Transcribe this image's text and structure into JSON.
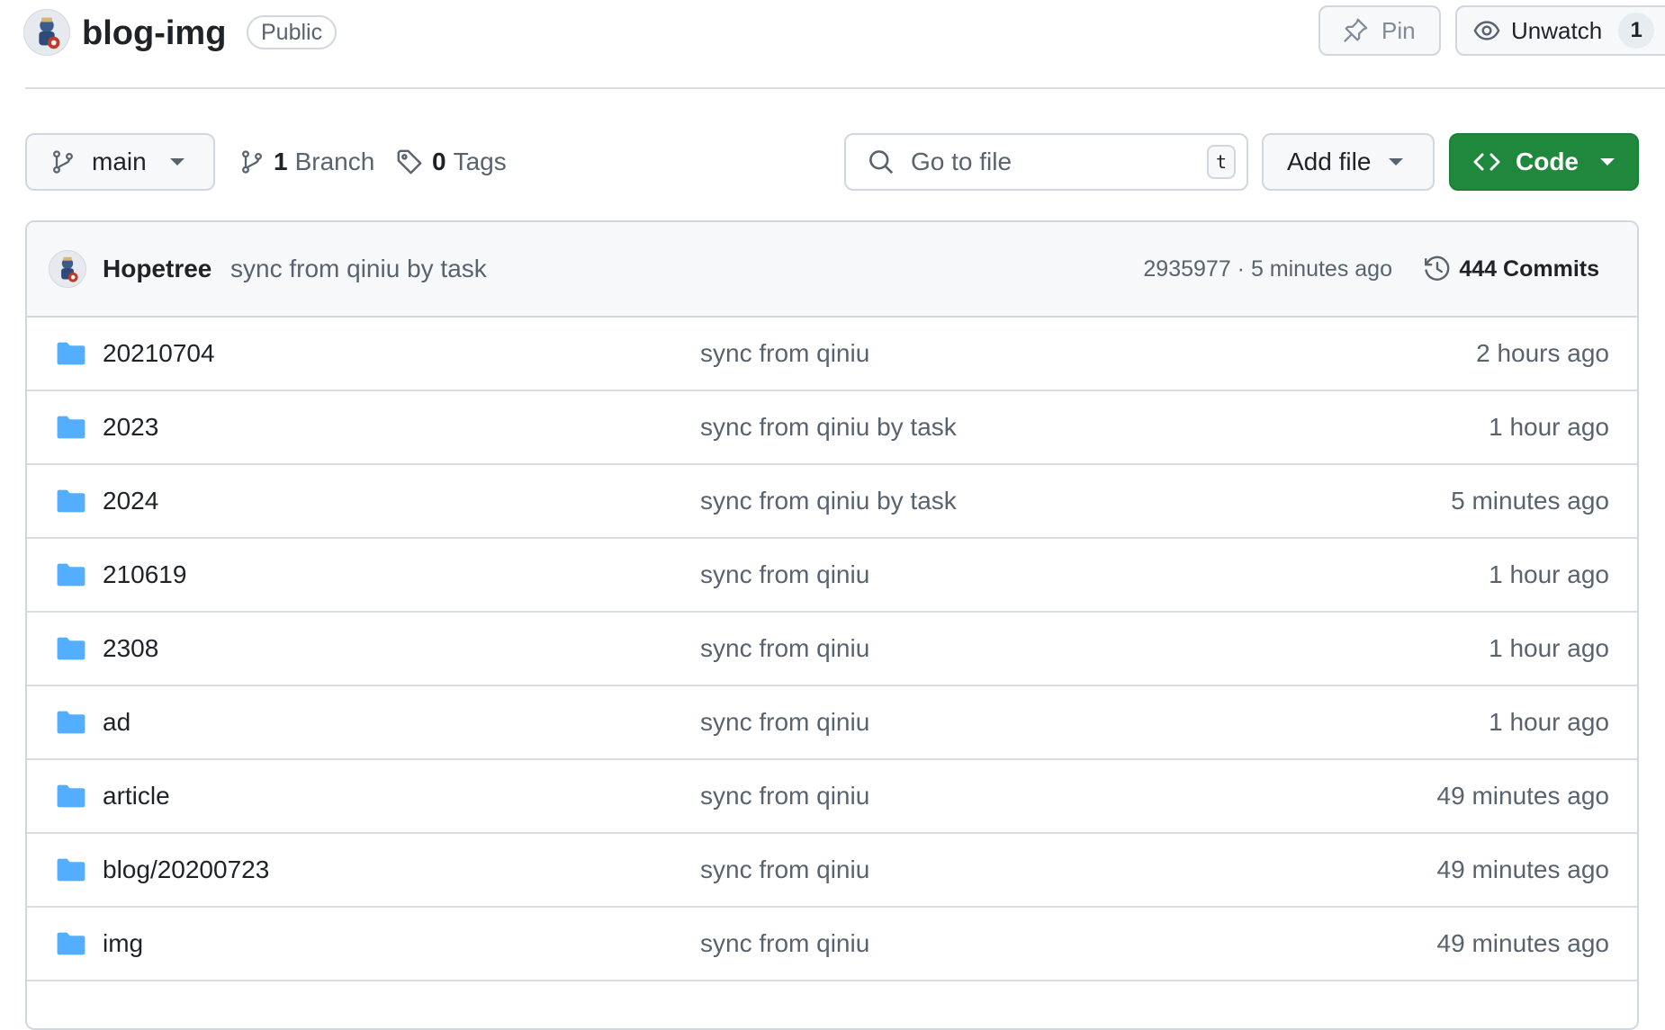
{
  "repo": {
    "name": "blog-img",
    "visibility": "Public"
  },
  "header_actions": {
    "pin_label": "Pin",
    "unwatch_label": "Unwatch",
    "watch_count": "1"
  },
  "toolbar": {
    "branch_name": "main",
    "branches_count": "1",
    "branches_label": "Branch",
    "tags_count": "0",
    "tags_label": "Tags",
    "search_placeholder": "Go to file",
    "search_shortcut": "t",
    "add_file_label": "Add file",
    "code_label": "Code"
  },
  "latest_commit": {
    "author": "Hopetree",
    "message": "sync from qiniu by task",
    "meta": "2935977 · 5 minutes ago",
    "commits_label": "444 Commits"
  },
  "files": [
    {
      "name": "20210704",
      "message": "sync from qiniu",
      "time": "2 hours ago"
    },
    {
      "name": "2023",
      "message": "sync from qiniu by task",
      "time": "1 hour ago"
    },
    {
      "name": "2024",
      "message": "sync from qiniu by task",
      "time": "5 minutes ago"
    },
    {
      "name": "210619",
      "message": "sync from qiniu",
      "time": "1 hour ago"
    },
    {
      "name": "2308",
      "message": "sync from qiniu",
      "time": "1 hour ago"
    },
    {
      "name": "ad",
      "message": "sync from qiniu",
      "time": "1 hour ago"
    },
    {
      "name": "article",
      "message": "sync from qiniu",
      "time": "49 minutes ago"
    },
    {
      "name": "blog/20200723",
      "message": "sync from qiniu",
      "time": "49 minutes ago"
    },
    {
      "name": "img",
      "message": "sync from qiniu",
      "time": "49 minutes ago"
    }
  ],
  "icons": {
    "folder": "folder-icon",
    "branch": "git-branch-icon",
    "tag": "tag-icon",
    "search": "search-icon",
    "code": "code-icon",
    "pin": "pin-icon",
    "eye": "eye-icon",
    "history": "history-icon"
  },
  "colors": {
    "folder": "#54aeff",
    "code_button": "#1f883d",
    "muted_text": "#59636e",
    "border": "#d0d7de"
  }
}
